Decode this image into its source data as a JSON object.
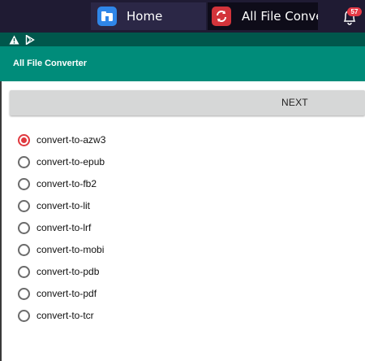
{
  "taskbar": {
    "tabs": [
      {
        "label": "Home",
        "icon": "folder-home-icon",
        "color": "#2f86e8"
      },
      {
        "label": "All File Conver",
        "icon": "refresh-arrows-icon",
        "color": "#d3343b"
      }
    ],
    "notification_count": "57"
  },
  "statusbar": {
    "icons": [
      "warning-icon",
      "play-store-icon"
    ]
  },
  "appbar": {
    "title": "All File Converter",
    "color": "#008c7a"
  },
  "actions": {
    "next_label": "NEXT"
  },
  "options": {
    "selected": "convert-to-azw3",
    "items": [
      "convert-to-azw3",
      "convert-to-epub",
      "convert-to-fb2",
      "convert-to-lit",
      "convert-to-lrf",
      "convert-to-mobi",
      "convert-to-pdb",
      "convert-to-pdf",
      "convert-to-tcr"
    ]
  }
}
